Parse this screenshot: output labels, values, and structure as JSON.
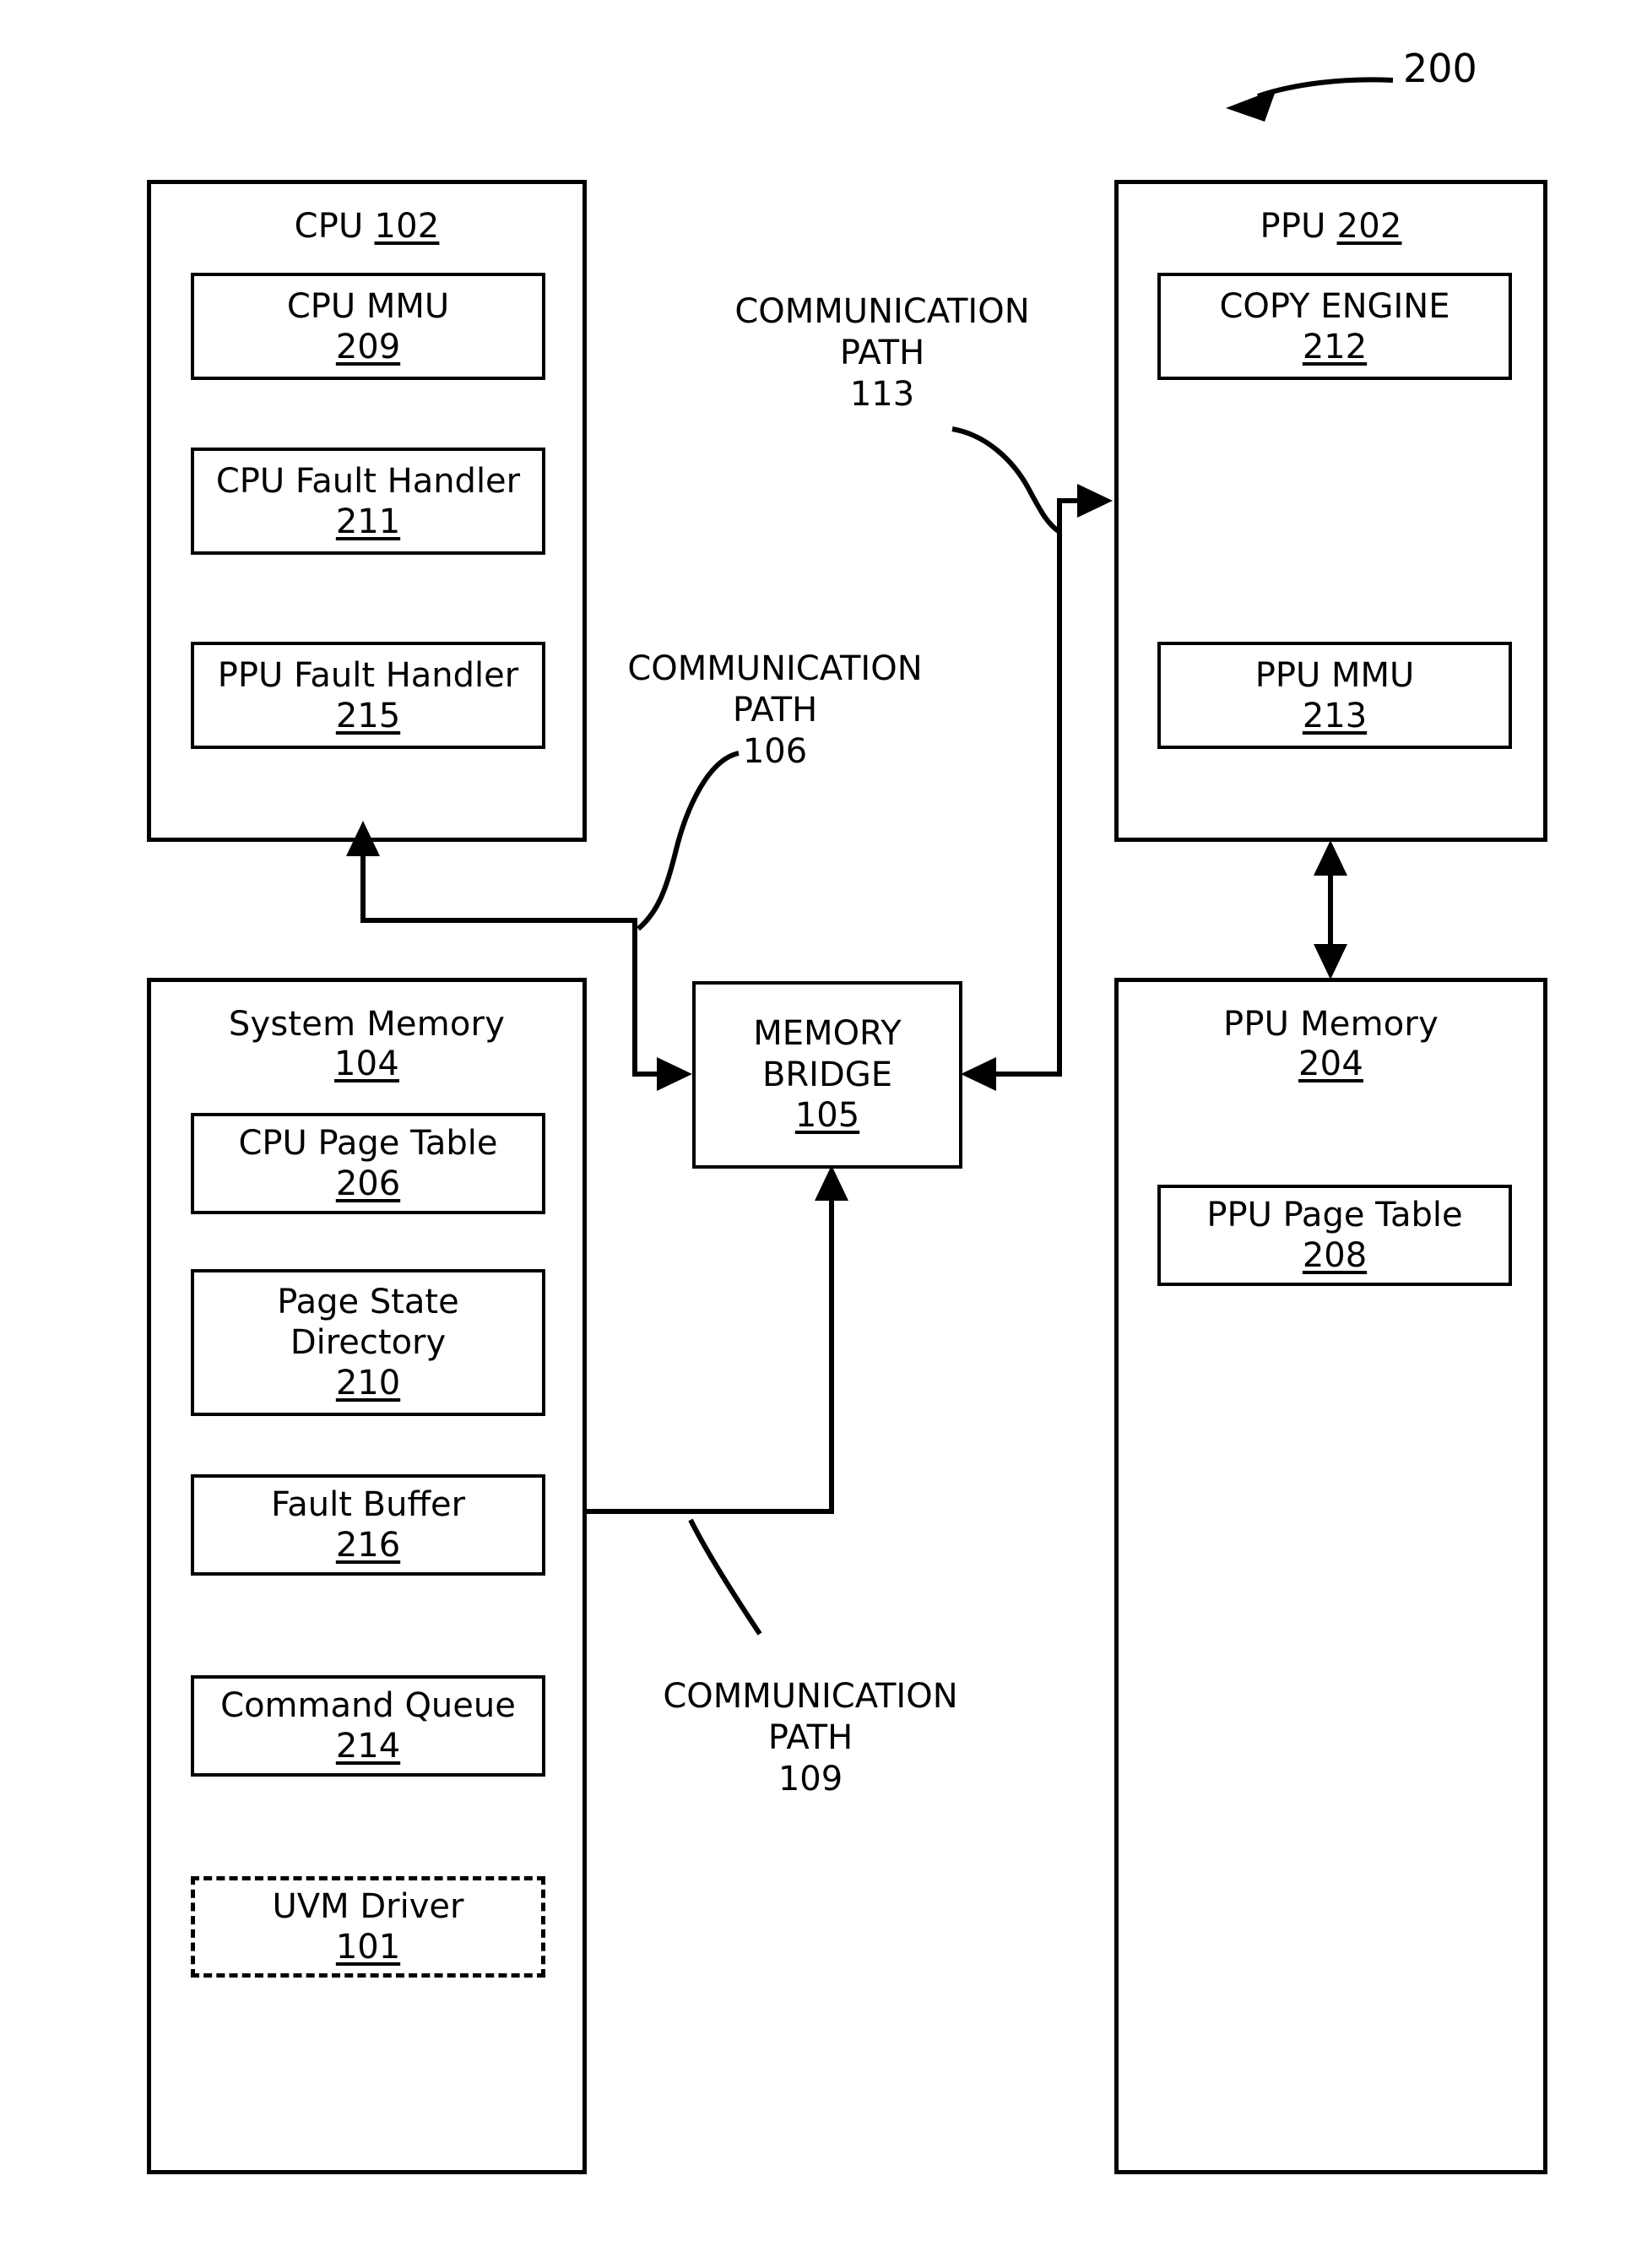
{
  "figure": {
    "number": "200"
  },
  "cpu": {
    "title": "CPU",
    "ref": "102",
    "components": [
      {
        "label": "CPU MMU",
        "ref": "209"
      },
      {
        "label": "CPU Fault Handler",
        "ref": "211"
      },
      {
        "label": "PPU Fault Handler",
        "ref": "215"
      }
    ]
  },
  "ppu": {
    "title": "PPU",
    "ref": "202",
    "components": [
      {
        "label": "COPY ENGINE",
        "ref": "212"
      },
      {
        "label": "PPU MMU",
        "ref": "213"
      }
    ]
  },
  "system_memory": {
    "title": "System Memory",
    "ref": "104",
    "components": [
      {
        "label": "CPU Page Table",
        "ref": "206"
      },
      {
        "label": "Page State Directory",
        "ref": "210"
      },
      {
        "label": "Fault Buffer",
        "ref": "216"
      },
      {
        "label": "Command Queue",
        "ref": "214"
      },
      {
        "label": "UVM Driver",
        "ref": "101"
      }
    ]
  },
  "ppu_memory": {
    "title": "PPU Memory",
    "ref": "204",
    "components": [
      {
        "label": "PPU Page Table",
        "ref": "208"
      }
    ]
  },
  "memory_bridge": {
    "line1": "MEMORY",
    "line2": "BRIDGE",
    "ref": "105"
  },
  "communication_paths": [
    {
      "line1": "COMMUNICATION",
      "line2": "PATH",
      "ref": "113"
    },
    {
      "line1": "COMMUNICATION",
      "line2": "PATH",
      "ref": "106"
    },
    {
      "line1": "COMMUNICATION",
      "line2": "PATH",
      "ref": "109"
    }
  ]
}
